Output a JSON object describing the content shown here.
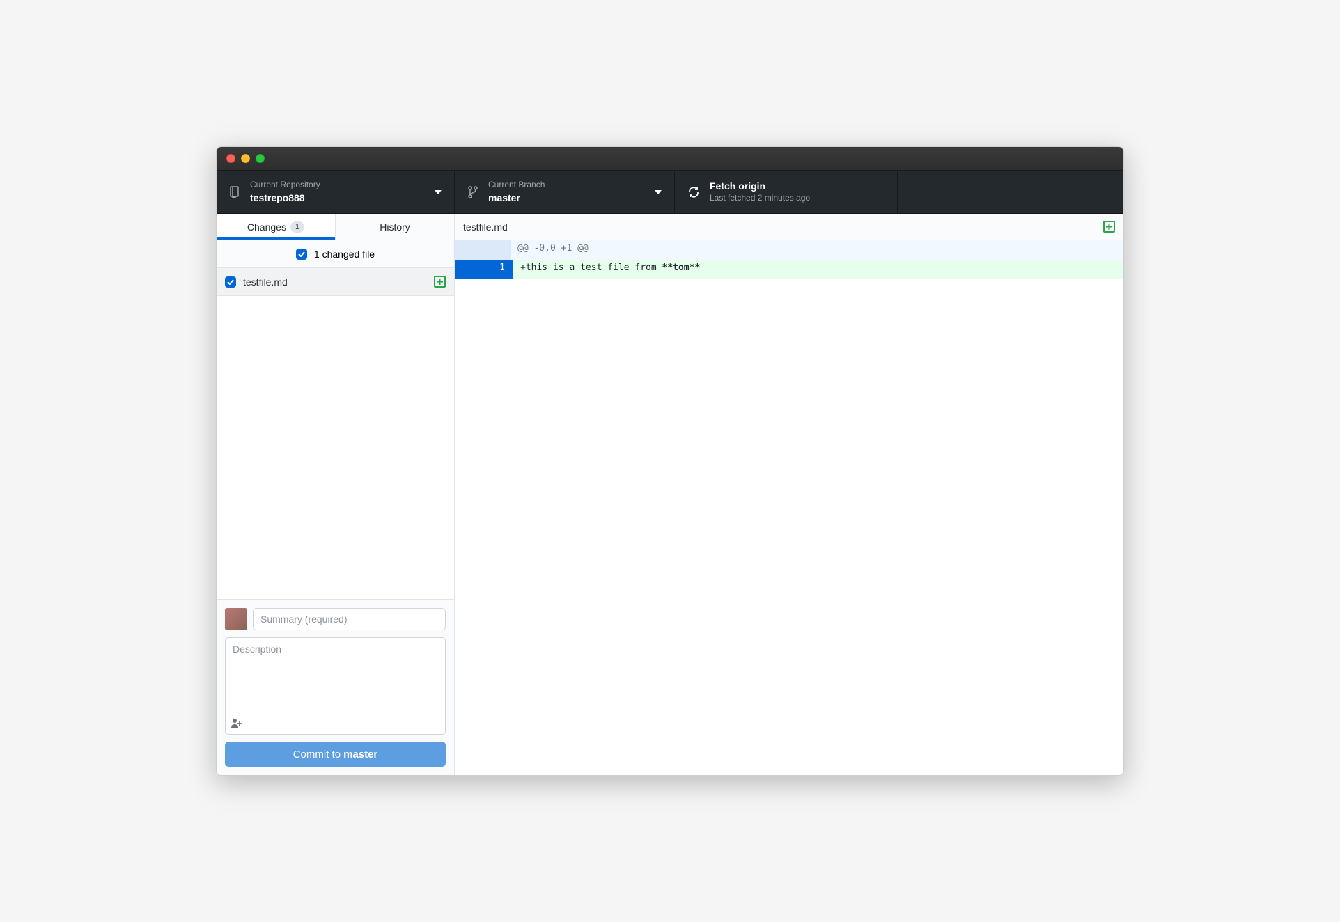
{
  "toolbar": {
    "repo": {
      "label": "Current Repository",
      "name": "testrepo888"
    },
    "branch": {
      "label": "Current Branch",
      "name": "master"
    },
    "fetch": {
      "label": "Fetch origin",
      "status": "Last fetched 2 minutes ago"
    }
  },
  "tabs": {
    "changes": {
      "label": "Changes",
      "badge": "1"
    },
    "history": {
      "label": "History"
    }
  },
  "changes": {
    "summary": "1 changed file",
    "files": [
      {
        "name": "testfile.md",
        "status": "added"
      }
    ]
  },
  "commit": {
    "summary_placeholder": "Summary (required)",
    "description_placeholder": "Description",
    "button_prefix": "Commit to ",
    "button_branch": "master"
  },
  "diff": {
    "filename": "testfile.md",
    "hunk_header": "@@ -0,0 +1 @@",
    "lines": [
      {
        "old": "",
        "new": "1",
        "prefix": "+",
        "text": "this is a test file from ",
        "bold": "**tom**"
      }
    ]
  }
}
